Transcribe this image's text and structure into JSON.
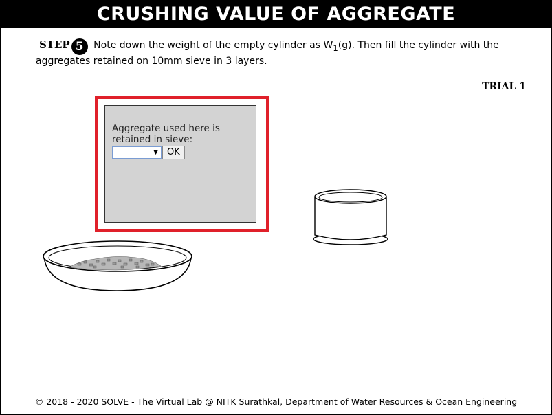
{
  "header": {
    "title": "CRUSHING VALUE OF AGGREGATE"
  },
  "step": {
    "label": "STEP",
    "number": "5",
    "text_before_sub": "Note down the weight of the empty cylinder as W",
    "subscript": "1",
    "text_after_sub": "(g). Then fill the cylinder with the aggregates retained on 10mm sieve in 3 layers."
  },
  "trial": {
    "label": "TRIAL 1"
  },
  "panel": {
    "prompt": "Aggregate used here is retained in sieve:",
    "select_value": "",
    "ok_label": "OK",
    "highlight_color": "#e0202a"
  },
  "footer": {
    "text": "© 2018 - 2020 SOLVE - The Virtual Lab @ NITK Surathkal, Department of Water Resources & Ocean Engineering"
  },
  "icons": [
    "chevron-down-icon",
    "aggregate-bowl-icon",
    "cylinder-icon"
  ]
}
